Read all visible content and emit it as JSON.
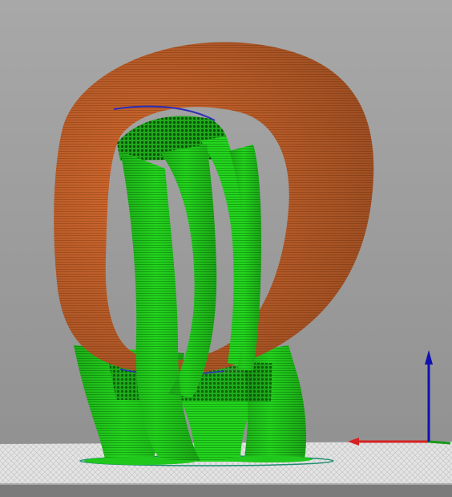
{
  "viewport": {
    "background_top": "#a9a9a9",
    "background_bottom": "#8e8e8e"
  },
  "scene": {
    "objects": [
      {
        "name": "model-ring",
        "color": "#d2692f",
        "shade": "#a9531f"
      },
      {
        "name": "tree-supports",
        "color": "#22d11d",
        "shade": "#12960f"
      },
      {
        "name": "support-interface-dense",
        "color": "#0c5f0a"
      }
    ],
    "bed": {
      "color": "#e3e3e3",
      "grid_color": "#bdbdbd"
    },
    "origin_gizmo": {
      "axes": [
        {
          "name": "x-axis",
          "color": "#d62222"
        },
        {
          "name": "y-axis",
          "color": "#1a9a1a"
        },
        {
          "name": "z-axis",
          "color": "#1010b0"
        }
      ]
    }
  }
}
